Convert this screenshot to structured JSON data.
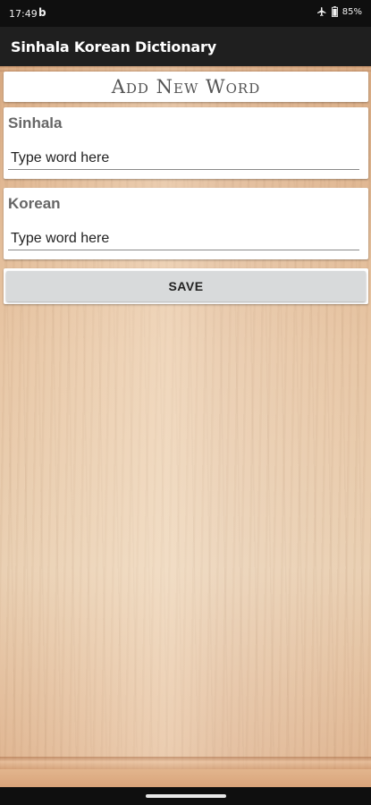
{
  "status_bar": {
    "time": "17:49",
    "notification_glyph": "b",
    "battery": "85%",
    "icons": [
      "airplane-icon",
      "battery-icon"
    ]
  },
  "app_bar": {
    "title": "Sinhala Korean Dictionary"
  },
  "form": {
    "title": "Add New Word",
    "sinhala": {
      "label": "Sinhala",
      "placeholder": "Type word here",
      "value": ""
    },
    "korean": {
      "label": "Korean",
      "placeholder": "Type word here",
      "value": ""
    },
    "save_label": "SAVE"
  },
  "colors": {
    "app_bar": "#1f1f1f",
    "status_bar": "#0f0f0f",
    "card": "#ffffff",
    "save_button": "#d8dadb",
    "wood": "#e8c7a6"
  }
}
